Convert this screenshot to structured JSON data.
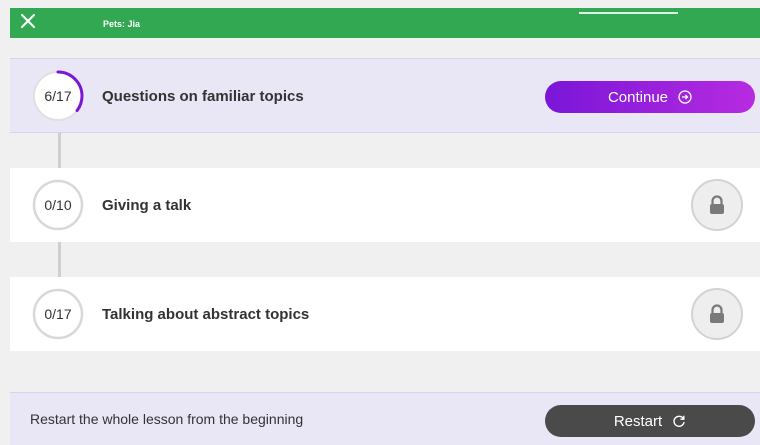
{
  "header": {
    "breadcrumb": "Pets: Jia",
    "progress_fraction": 0.83,
    "colors": {
      "bar": "#33a852"
    }
  },
  "lessons": [
    {
      "progress": "6/17",
      "done": 6,
      "total": 17,
      "title": "Questions on familiar topics",
      "status": "active"
    },
    {
      "progress": "0/10",
      "done": 0,
      "total": 10,
      "title": "Giving a talk",
      "status": "locked"
    },
    {
      "progress": "0/17",
      "done": 0,
      "total": 17,
      "title": "Talking about abstract topics",
      "status": "locked"
    }
  ],
  "continue_button": {
    "label": "Continue",
    "icon": "arrow-circle-right-icon"
  },
  "footer": {
    "text": "Restart the whole lesson from the beginning",
    "restart_label": "Restart",
    "icon": "refresh-icon"
  },
  "colors": {
    "accent_purple": "#7a16d8",
    "active_row_bg": "#e9e6f5",
    "restart_bg": "#4a4a4a"
  }
}
